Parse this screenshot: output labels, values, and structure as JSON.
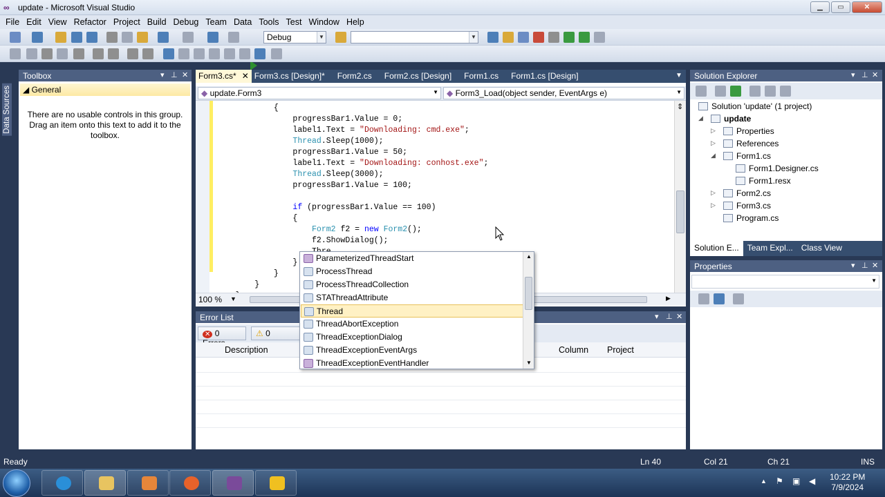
{
  "window": {
    "title": "update - Microsoft Visual Studio"
  },
  "menu": [
    "File",
    "Edit",
    "View",
    "Refactor",
    "Project",
    "Build",
    "Debug",
    "Team",
    "Data",
    "Tools",
    "Test",
    "Window",
    "Help"
  ],
  "toolbar": {
    "config": "Debug",
    "platform": ""
  },
  "side_strip": {
    "label": "Data Sources"
  },
  "toolbox": {
    "title": "Toolbox",
    "group": "General",
    "message": "There are no usable controls in this group. Drag an item onto this text to add it to the toolbox."
  },
  "editor": {
    "tabs": [
      {
        "label": "Form3.cs*",
        "active": true
      },
      {
        "label": "Form3.cs [Design]*"
      },
      {
        "label": "Form2.cs"
      },
      {
        "label": "Form2.cs [Design]"
      },
      {
        "label": "Form1.cs"
      },
      {
        "label": "Form1.cs [Design]"
      }
    ],
    "type_nav": "update.Form3",
    "member_nav": "Form3_Load(object sender, EventArgs e)",
    "zoom": "100 %",
    "code_lines": [
      [
        {
          "t": "            {"
        }
      ],
      [
        {
          "t": "                progressBar1.Value = 0;"
        }
      ],
      [
        {
          "t": "                label1.Text = "
        },
        {
          "t": "\"Downloading: cmd.exe\"",
          "c": "st"
        },
        {
          "t": ";"
        }
      ],
      [
        {
          "t": "                "
        },
        {
          "t": "Thread",
          "c": "ty"
        },
        {
          "t": ".Sleep(1000);"
        }
      ],
      [
        {
          "t": "                progressBar1.Value = 50;"
        }
      ],
      [
        {
          "t": "                label1.Text = "
        },
        {
          "t": "\"Downloading: conhost.exe\"",
          "c": "st"
        },
        {
          "t": ";"
        }
      ],
      [
        {
          "t": "                "
        },
        {
          "t": "Thread",
          "c": "ty"
        },
        {
          "t": ".Sleep(3000);"
        }
      ],
      [
        {
          "t": "                progressBar1.Value = 100;"
        }
      ],
      [
        {
          "t": ""
        }
      ],
      [
        {
          "t": "                "
        },
        {
          "t": "if",
          "c": "kw"
        },
        {
          "t": " (progressBar1.Value == 100)"
        }
      ],
      [
        {
          "t": "                {"
        }
      ],
      [
        {
          "t": "                    "
        },
        {
          "t": "Form2",
          "c": "ty"
        },
        {
          "t": " f2 = "
        },
        {
          "t": "new",
          "c": "kw"
        },
        {
          "t": " "
        },
        {
          "t": "Form2",
          "c": "ty"
        },
        {
          "t": "();"
        }
      ],
      [
        {
          "t": "                    f2.ShowDialog();"
        }
      ],
      [
        {
          "t": "                    Thre"
        }
      ],
      [
        {
          "t": "                }"
        }
      ],
      [
        {
          "t": "            }"
        }
      ],
      [
        {
          "t": "        }"
        }
      ],
      [
        {
          "t": "    }"
        }
      ]
    ]
  },
  "intellisense": {
    "items": [
      {
        "label": "ParameterizedThreadStart",
        "kind": "delegate"
      },
      {
        "label": "ProcessThread",
        "kind": "class"
      },
      {
        "label": "ProcessThreadCollection",
        "kind": "class"
      },
      {
        "label": "STAThreadAttribute",
        "kind": "class"
      },
      {
        "label": "Thread",
        "kind": "class",
        "selected": true
      },
      {
        "label": "ThreadAbortException",
        "kind": "class"
      },
      {
        "label": "ThreadExceptionDialog",
        "kind": "class"
      },
      {
        "label": "ThreadExceptionEventArgs",
        "kind": "class"
      },
      {
        "label": "ThreadExceptionEventHandler",
        "kind": "delegate"
      }
    ]
  },
  "error_list": {
    "title": "Error List",
    "errors_btn": "0 Errors",
    "warnings_btn": "0 Warnin",
    "columns": {
      "description": "Description",
      "column": "Column",
      "project": "Project"
    }
  },
  "solution_explorer": {
    "title": "Solution Explorer",
    "nodes": [
      {
        "label": "Solution 'update' (1 project)",
        "level": 0,
        "toggle": ""
      },
      {
        "label": "update",
        "level": 1,
        "toggle": "◢",
        "bold": true
      },
      {
        "label": "Properties",
        "level": 2,
        "toggle": "▷"
      },
      {
        "label": "References",
        "level": 2,
        "toggle": "▷"
      },
      {
        "label": "Form1.cs",
        "level": 2,
        "toggle": "◢"
      },
      {
        "label": "Form1.Designer.cs",
        "level": 3,
        "toggle": ""
      },
      {
        "label": "Form1.resx",
        "level": 3,
        "toggle": ""
      },
      {
        "label": "Form2.cs",
        "level": 2,
        "toggle": "▷"
      },
      {
        "label": "Form3.cs",
        "level": 2,
        "toggle": "▷"
      },
      {
        "label": "Program.cs",
        "level": 2,
        "toggle": ""
      }
    ],
    "bottom_tabs": [
      "Solution E...",
      "Team Expl...",
      "Class View"
    ]
  },
  "properties": {
    "title": "Properties"
  },
  "status": {
    "left": "Ready",
    "ln": "Ln 40",
    "col": "Col 21",
    "ch": "Ch 21",
    "mode": "INS"
  },
  "taskbar": {
    "time": "10:22 PM",
    "date": "7/9/2024"
  },
  "colors": {
    "accent": "#293955",
    "keyword": "#0000ff",
    "type": "#2b91af",
    "string": "#a31515",
    "active_tab": "#fff8d8"
  }
}
